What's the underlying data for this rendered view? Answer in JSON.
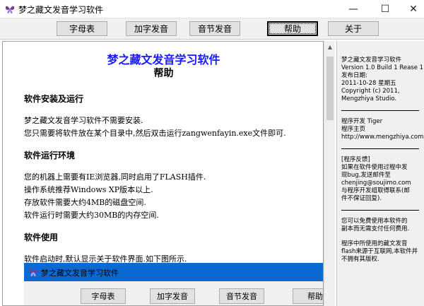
{
  "window": {
    "title": "梦之藏文发音学习软件",
    "controls": {
      "minimize": "—",
      "maximize": "☐",
      "close": "✕"
    }
  },
  "toolbar": {
    "buttons": [
      "字母表",
      "加字发音",
      "音节发音",
      "帮助",
      "关于"
    ]
  },
  "help": {
    "title": "梦之藏文发音学习软件",
    "subtitle": "帮助",
    "sections": [
      {
        "heading": "软件安装及运行",
        "lines": [
          "梦之藏文发音学习软件不需要安装.",
          "您只需要将软件放在某个目录中,然后双击运行zangwenfayin.exe文件即可."
        ]
      },
      {
        "heading": "软件运行环境",
        "lines": [
          "您的机器上需要有IE浏览器,同时启用了FLASH插件.",
          "操作系统推荐Windows XP版本以上.",
          "存放软件需要大约4MB的磁盘空间.",
          "软件运行时需要大约30MB的内存空间."
        ]
      },
      {
        "heading": "软件使用",
        "lines": [
          "软件启动时,默认显示关于软件界面.如下图所示."
        ]
      }
    ],
    "embedded_screenshot": {
      "title": "梦之藏文发音学习软件",
      "buttons": [
        "字母表",
        "加字发音",
        "音节发音",
        "帮助"
      ]
    }
  },
  "side": {
    "lines": [
      "梦之藏文发音学习软件",
      "Version 1.0 Build 1 Rease 1",
      "发布日期:",
      "2011-10-28 星期五",
      "Copyright (c) 2011,",
      "Mengzhiya Studio.",
      "程序开发  Tiger",
      "程序主页",
      "http://www.mengzhiya.com",
      "[程序反馈]",
      " 如果在软件使用过程中发",
      "现bug,发送邮件至",
      "chenjing@soujimo.com",
      " 与程序开发组取得联系(邮",
      "件不保证回复).",
      " 您可以免费使用本软件的",
      "副本而无需支付任何费用.",
      " 程序中所使用的藏文发音",
      "flash来源于互联网,本软件并",
      "不拥有其版权."
    ]
  },
  "colors": {
    "title_blue": "#1a1aff",
    "embed_titlebar": "#0a6ad1"
  },
  "icons": [
    "butterfly-app-icon",
    "minimize-icon",
    "maximize-icon",
    "close-icon",
    "scroll-up-arrow-icon"
  ]
}
